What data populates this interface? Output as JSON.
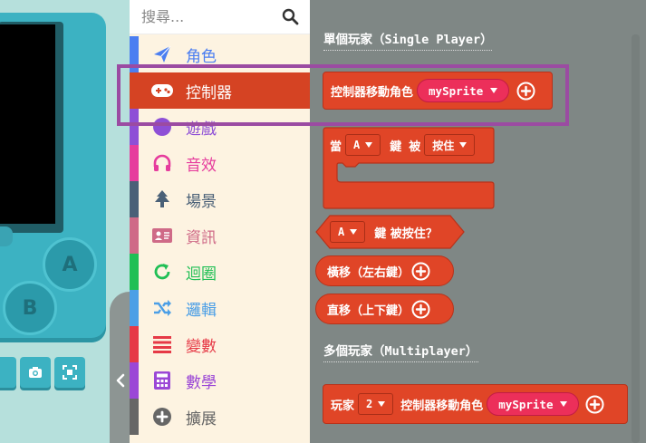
{
  "search": {
    "placeholder": "搜尋..."
  },
  "simulator": {
    "button_a": "A",
    "button_b": "B"
  },
  "toolbox": {
    "categories": [
      {
        "label": "角色",
        "icon": "paper-plane-icon",
        "color": "#4b7ef1"
      },
      {
        "label": "控制器",
        "icon": "gamepad-icon",
        "color": "#d54323"
      },
      {
        "label": "遊戲",
        "icon": "circle-icon",
        "color": "#8e4fd6"
      },
      {
        "label": "音效",
        "icon": "headphones-icon",
        "color": "#e63c9d"
      },
      {
        "label": "場景",
        "icon": "tree-icon",
        "color": "#4a6077"
      },
      {
        "label": "資訊",
        "icon": "id-card-icon",
        "color": "#cf6a87"
      },
      {
        "label": "迴圈",
        "icon": "refresh-icon",
        "color": "#20bf55"
      },
      {
        "label": "邏輯",
        "icon": "shuffle-icon",
        "color": "#4c9fe6"
      },
      {
        "label": "變數",
        "icon": "list-icon",
        "color": "#e63946"
      },
      {
        "label": "數學",
        "icon": "calculator-icon",
        "color": "#9b47d6"
      },
      {
        "label": "擴展",
        "icon": "plus-circle-icon",
        "color": "#666666"
      }
    ],
    "selected": "控制器"
  },
  "workspace": {
    "single_player": {
      "prefix": "單個玩家（",
      "name": "Single Player",
      "suffix": "）"
    },
    "multi_player": {
      "prefix": "多個玩家（",
      "name": "Multiplayer",
      "suffix": "）"
    },
    "blocks": {
      "move_sprite": {
        "label": "控制器移動角色",
        "sprite": "mySprite"
      },
      "on_button": {
        "when": "當",
        "button": "A",
        "key": "鍵",
        "by": "被",
        "event": "按住"
      },
      "is_pressed": {
        "button": "A",
        "label": "鍵 被按住？"
      },
      "dx": {
        "label": "橫移（左右鍵）"
      },
      "dy": {
        "label": "直移（上下鍵）"
      },
      "player_move": {
        "player": "玩家",
        "number": "2",
        "label": "控制器移動角色",
        "sprite": "mySprite"
      }
    }
  },
  "colors": {
    "control_block": "#e04527",
    "sprite_reporter": "#ec2f5a",
    "highlight": "#9b4ba2"
  }
}
